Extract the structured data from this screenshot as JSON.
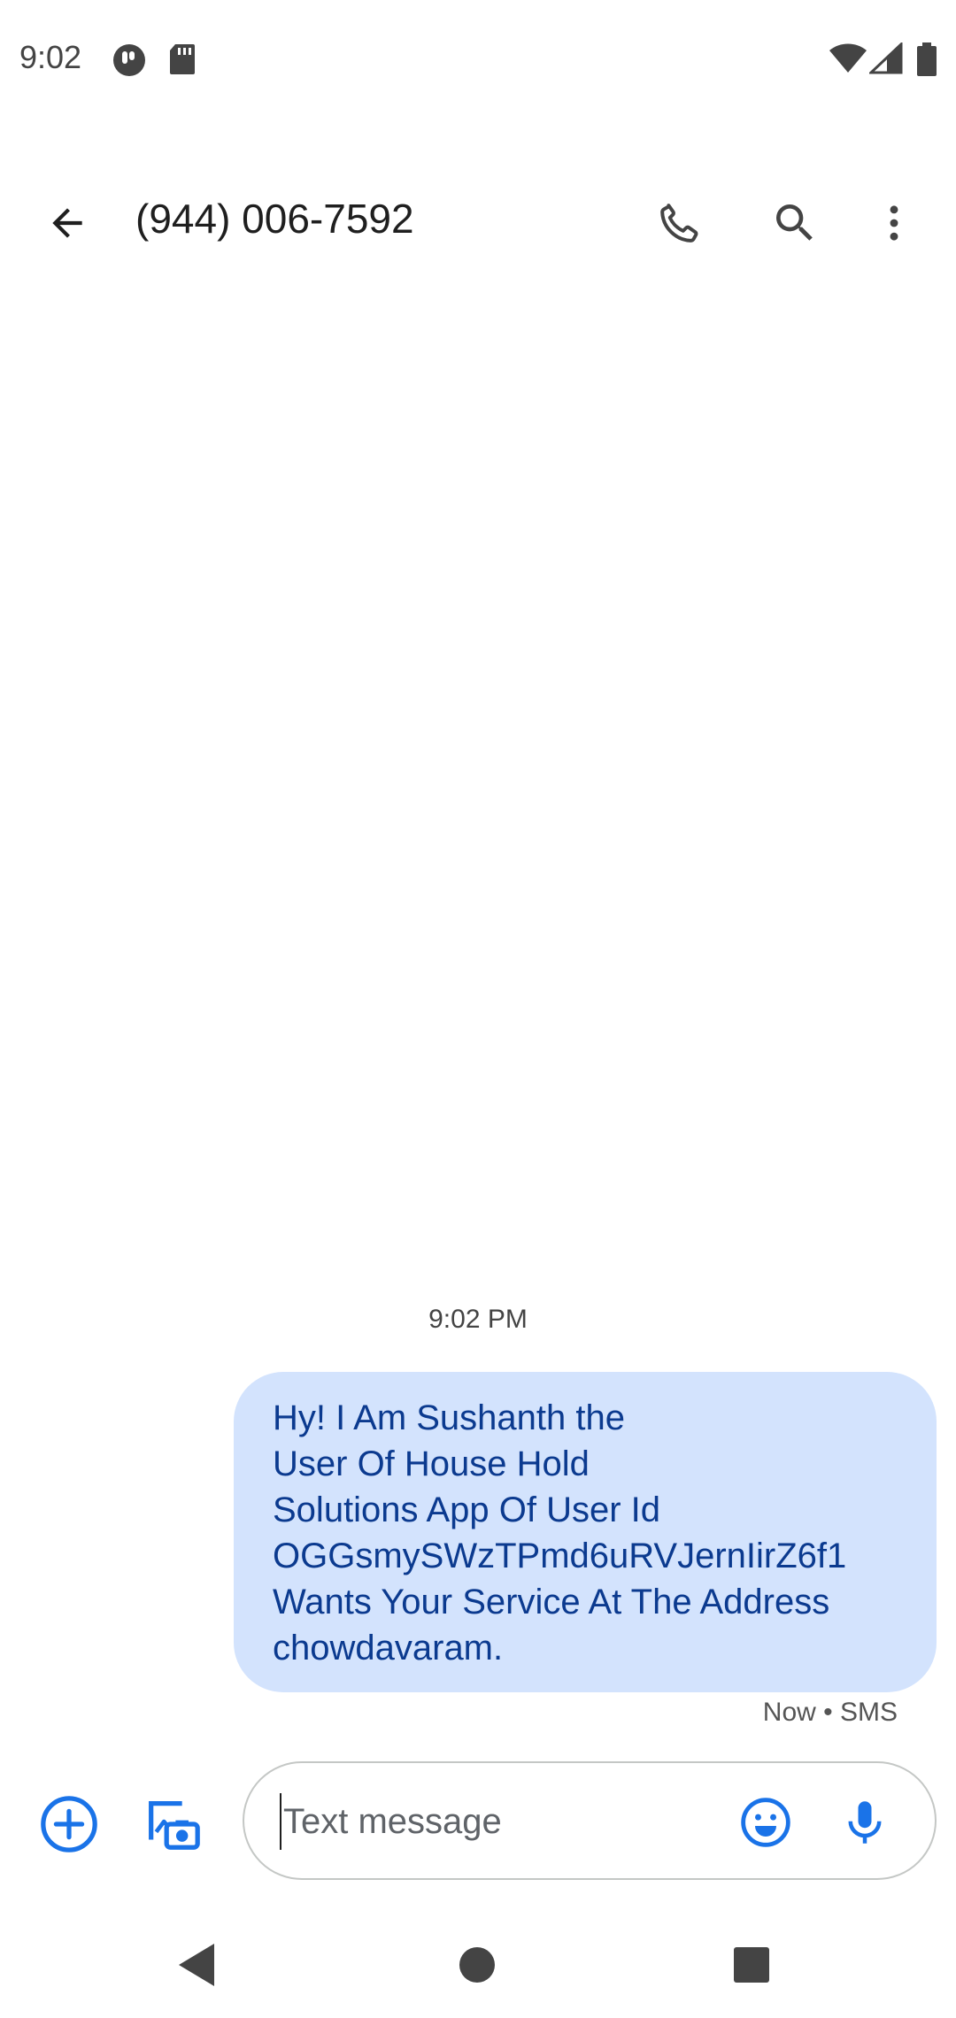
{
  "status_bar": {
    "time": "9:02",
    "icons": [
      "app-notification-icon",
      "sd-card-icon",
      "wifi-icon",
      "cell-signal-icon",
      "battery-icon"
    ]
  },
  "app_bar": {
    "title": "(944) 006-7592",
    "actions": [
      "call-icon",
      "search-icon",
      "more-vert-icon"
    ]
  },
  "conversation": {
    "timestamp_header": "9:02 PM",
    "messages": [
      {
        "direction": "outgoing",
        "text": "Hy! I Am Sushanth the\nUser Of House Hold\nSolutions App Of User Id\nOGGsmySWzTPmd6uRVJernIirZ6f1\nWants Your Service At The Address\nchowdavaram.",
        "meta": "Now • SMS"
      }
    ]
  },
  "compose": {
    "placeholder": "Text message",
    "value": ""
  },
  "colors": {
    "accent": "#1a73e8",
    "bubble_background": "#d3e3fd",
    "bubble_text": "#0b3a8f"
  }
}
